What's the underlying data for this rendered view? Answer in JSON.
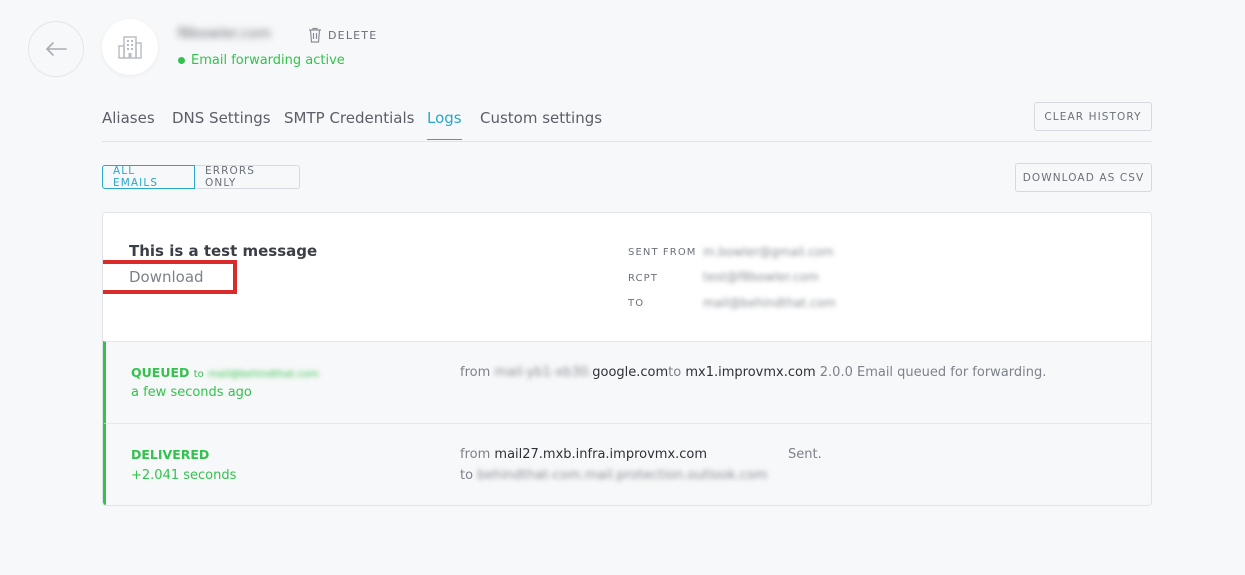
{
  "header": {
    "domain_name": "f8bowler.com",
    "delete_label": "DELETE",
    "status_text": "Email forwarding active",
    "status_color": "#33c24d"
  },
  "tabs": [
    {
      "label": "Aliases",
      "active": false
    },
    {
      "label": "DNS Settings",
      "active": false
    },
    {
      "label": "SMTP Credentials",
      "active": false
    },
    {
      "label": "Logs",
      "active": true
    },
    {
      "label": "Custom settings",
      "active": false
    }
  ],
  "toolbar": {
    "clear_history_label": "CLEAR HISTORY",
    "filter_all_label": "ALL EMAILS",
    "filter_errors_label": "ERRORS ONLY",
    "download_csv_label": "DOWNLOAD AS CSV"
  },
  "message": {
    "subject": "This is a test message",
    "download_label": "Download",
    "sent_from_label": "SENT FROM",
    "sent_from_value": "m.bowler@gmail.com",
    "rcpt_label": "RCPT",
    "rcpt_value": "test@f8bowler.com",
    "to_label": "TO",
    "to_value": "mail@behindthat.com"
  },
  "events": [
    {
      "status": "QUEUED",
      "to_word": "to",
      "to_address": "mail@behindthat.com",
      "time": "a few seconds ago",
      "from_word": "from",
      "from_host_blurred": "mail-yb1-xb30.",
      "from_host": "google.com",
      "to_host_word": "to",
      "to_host": "mx1.improvmx.com",
      "message": "2.0.0 Email queued for forwarding."
    },
    {
      "status": "DELIVERED",
      "time": "+2.041 seconds",
      "from_word": "from",
      "from_host": "mail27.mxb.infra.improvmx.com",
      "to_word": "to",
      "to_host": "behindthat-com.mail.protection.outlook.com",
      "message": "Sent."
    }
  ],
  "colors": {
    "accent": "#2aa7c9",
    "success": "#33c24d",
    "highlight": "#d92b2b"
  },
  "icons": [
    "back-arrow-icon",
    "building-icon",
    "trash-icon"
  ]
}
